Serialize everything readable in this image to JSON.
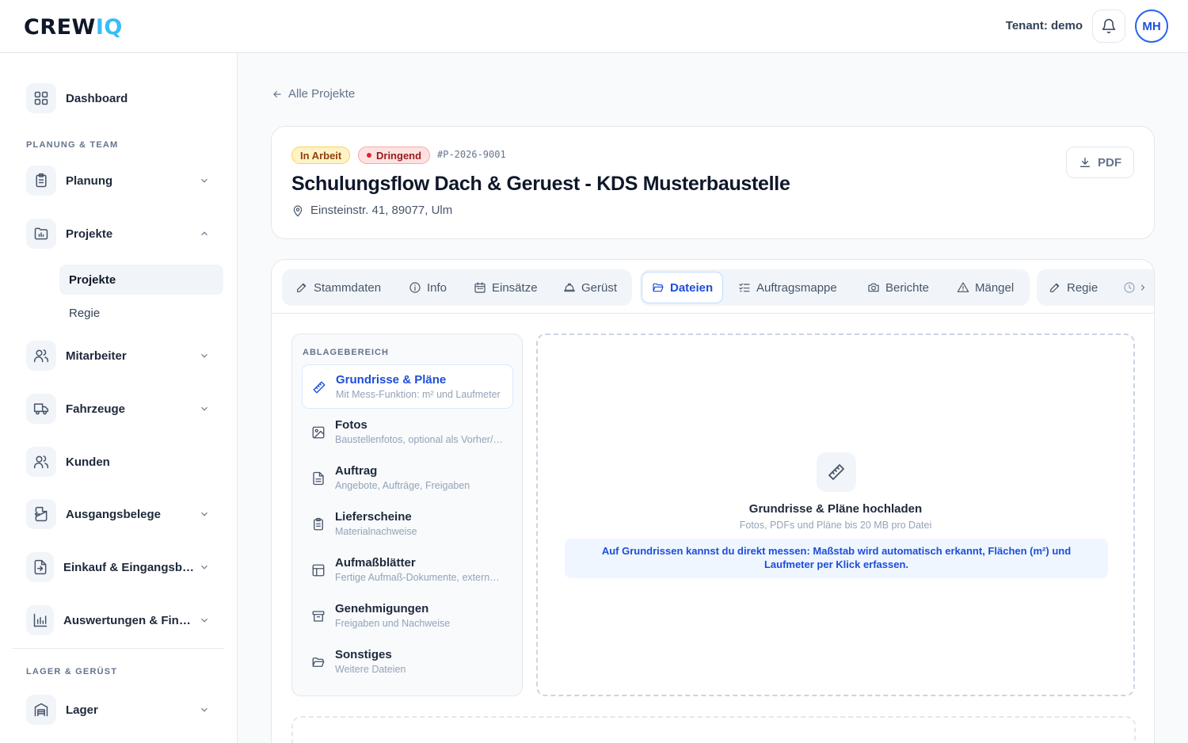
{
  "app": {
    "logo_main": "CREW",
    "logo_accent": "IQ"
  },
  "header": {
    "tenant": "Tenant: demo",
    "avatar_initials": "MH"
  },
  "sidebar": {
    "dashboard": "Dashboard",
    "section_planning": "PLANUNG & TEAM",
    "planung": "Planung",
    "projekte": "Projekte",
    "sub_projekte": "Projekte",
    "sub_regie": "Regie",
    "mitarbeiter": "Mitarbeiter",
    "fahrzeuge": "Fahrzeuge",
    "kunden": "Kunden",
    "ausgangsbelege": "Ausgangsbelege",
    "einkauf": "Einkauf & Eingangsbelege",
    "auswertungen": "Auswertungen & Finanzen",
    "section_lager": "LAGER & GERÜST",
    "lager": "Lager"
  },
  "breadcrumb": {
    "back_label": "Alle Projekte"
  },
  "project": {
    "status": "In Arbeit",
    "priority": "Dringend",
    "id": "#P-2026-9001",
    "title": "Schulungsflow Dach & Geruest - KDS Musterbaustelle",
    "address": "Einsteinstr. 41, 89077, Ulm",
    "pdf_label": "PDF"
  },
  "tabs": [
    {
      "label": "Stammdaten",
      "icon": "pencil-icon"
    },
    {
      "label": "Info",
      "icon": "info-icon"
    },
    {
      "label": "Einsätze",
      "icon": "calendar-icon"
    },
    {
      "label": "Gerüst",
      "icon": "helmet-icon"
    },
    {
      "label": "Dateien",
      "icon": "folder-icon",
      "active": true
    },
    {
      "label": "Auftragsmappe",
      "icon": "checklist-icon"
    },
    {
      "label": "Berichte",
      "icon": "camera-icon"
    },
    {
      "label": "Mängel",
      "icon": "warning-icon"
    },
    {
      "label": "Regie",
      "icon": "pencil-icon"
    }
  ],
  "storage": {
    "title": "ABLAGEBEREICH",
    "categories": [
      {
        "title": "Grundrisse & Pläne",
        "desc": "Mit Mess-Funktion: m² und Laufmeter",
        "icon": "ruler-icon",
        "active": true
      },
      {
        "title": "Fotos",
        "desc": "Baustellenfotos, optional als Vorher/Nachher",
        "icon": "image-icon"
      },
      {
        "title": "Auftrag",
        "desc": "Angebote, Aufträge, Freigaben",
        "icon": "document-icon"
      },
      {
        "title": "Lieferscheine",
        "desc": "Materialnachweise",
        "icon": "clipboard-icon"
      },
      {
        "title": "Aufmaßblätter",
        "desc": "Fertige Aufmaß-Dokumente, externe Aufmaße",
        "icon": "table-icon"
      },
      {
        "title": "Genehmigungen",
        "desc": "Freigaben und Nachweise",
        "icon": "archive-icon"
      },
      {
        "title": "Sonstiges",
        "desc": "Weitere Dateien",
        "icon": "folder-icon"
      }
    ]
  },
  "dropzone": {
    "title": "Grundrisse & Pläne hochladen",
    "subtitle": "Fotos, PDFs und Pläne bis 20 MB pro Datei",
    "hint": "Auf Grundrissen kannst du direkt messen: Maßstab wird automatisch erkannt, Flächen (m²) und Laufmeter per Klick erfassen."
  },
  "colors": {
    "accent": "#1d4ed8",
    "logo_accent": "#38bdf8",
    "status_bg": "#fef3c7",
    "priority_bg": "#fee2e2"
  }
}
